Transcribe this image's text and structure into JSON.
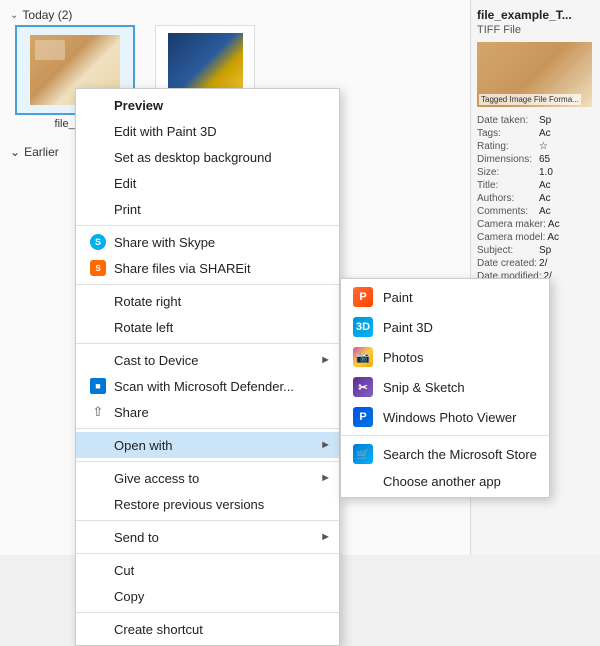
{
  "explorer": {
    "today_label": "Today (2)",
    "earlier_label": "Earlier",
    "file1_name": "file_ex...",
    "file2_name": ""
  },
  "right_panel": {
    "title": "file_example_T...",
    "type": "TIFF File",
    "thumb_label": "Tagged Image File Forma...",
    "meta": [
      {
        "key": "Date taken:",
        "val": "Sp"
      },
      {
        "key": "Tags:",
        "val": "Ac"
      },
      {
        "key": "Rating:",
        "val": "☆"
      },
      {
        "key": "Dimensions:",
        "val": "65"
      },
      {
        "key": "Size:",
        "val": "1.0"
      },
      {
        "key": "Title:",
        "val": "Ac"
      },
      {
        "key": "Authors:",
        "val": "Ac"
      },
      {
        "key": "Comments:",
        "val": "Ac"
      },
      {
        "key": "Camera maker:",
        "val": "Ac"
      },
      {
        "key": "Camera model:",
        "val": "Ac"
      },
      {
        "key": "Subject:",
        "val": "Sp"
      },
      {
        "key": "Date created:",
        "val": "2/"
      },
      {
        "key": "Date modified:",
        "val": "2/"
      }
    ]
  },
  "context_menu": {
    "items": [
      {
        "id": "preview",
        "label": "Preview",
        "bold": true,
        "icon": null,
        "submenu": false
      },
      {
        "id": "edit-paint3d",
        "label": "Edit with Paint 3D",
        "bold": false,
        "icon": null,
        "submenu": false
      },
      {
        "id": "set-desktop",
        "label": "Set as desktop background",
        "bold": false,
        "icon": null,
        "submenu": false
      },
      {
        "id": "edit",
        "label": "Edit",
        "bold": false,
        "icon": null,
        "submenu": false
      },
      {
        "id": "print",
        "label": "Print",
        "bold": false,
        "icon": null,
        "submenu": false
      },
      {
        "id": "sep1",
        "type": "sep"
      },
      {
        "id": "share-skype",
        "label": "Share with Skype",
        "bold": false,
        "icon": "skype",
        "submenu": false
      },
      {
        "id": "share-shareit",
        "label": "Share files via SHAREit",
        "bold": false,
        "icon": "shareit",
        "submenu": false
      },
      {
        "id": "sep2",
        "type": "sep"
      },
      {
        "id": "rotate-right",
        "label": "Rotate right",
        "bold": false,
        "icon": null,
        "submenu": false
      },
      {
        "id": "rotate-left",
        "label": "Rotate left",
        "bold": false,
        "icon": null,
        "submenu": false
      },
      {
        "id": "sep3",
        "type": "sep"
      },
      {
        "id": "cast",
        "label": "Cast to Device",
        "bold": false,
        "icon": null,
        "submenu": true
      },
      {
        "id": "defender",
        "label": "Scan with Microsoft Defender...",
        "bold": false,
        "icon": "defender",
        "submenu": false
      },
      {
        "id": "share",
        "label": "Share",
        "bold": false,
        "icon": "share",
        "submenu": false
      },
      {
        "id": "sep4",
        "type": "sep"
      },
      {
        "id": "open-with",
        "label": "Open with",
        "bold": false,
        "icon": null,
        "submenu": true,
        "highlighted": true
      },
      {
        "id": "sep5",
        "type": "sep"
      },
      {
        "id": "give-access",
        "label": "Give access to",
        "bold": false,
        "icon": null,
        "submenu": true
      },
      {
        "id": "restore-versions",
        "label": "Restore previous versions",
        "bold": false,
        "icon": null,
        "submenu": false
      },
      {
        "id": "sep6",
        "type": "sep"
      },
      {
        "id": "send-to",
        "label": "Send to",
        "bold": false,
        "icon": null,
        "submenu": true
      },
      {
        "id": "sep7",
        "type": "sep"
      },
      {
        "id": "cut",
        "label": "Cut",
        "bold": false,
        "icon": null,
        "submenu": false
      },
      {
        "id": "copy",
        "label": "Copy",
        "bold": false,
        "icon": null,
        "submenu": false
      },
      {
        "id": "sep8",
        "type": "sep"
      },
      {
        "id": "create-shortcut",
        "label": "Create shortcut",
        "bold": false,
        "icon": null,
        "submenu": false
      }
    ]
  },
  "submenu_openwith": {
    "items": [
      {
        "id": "paint",
        "label": "Paint",
        "icon": "paint"
      },
      {
        "id": "paint3d",
        "label": "Paint 3D",
        "icon": "paint3d"
      },
      {
        "id": "photos",
        "label": "Photos",
        "icon": "photos"
      },
      {
        "id": "snip",
        "label": "Snip & Sketch",
        "icon": "snip"
      },
      {
        "id": "photov",
        "label": "Windows Photo Viewer",
        "icon": "photov"
      },
      {
        "id": "sep",
        "type": "sep"
      },
      {
        "id": "store",
        "label": "Search the Microsoft Store",
        "icon": "store"
      },
      {
        "id": "another",
        "label": "Choose another app",
        "icon": null
      }
    ]
  }
}
